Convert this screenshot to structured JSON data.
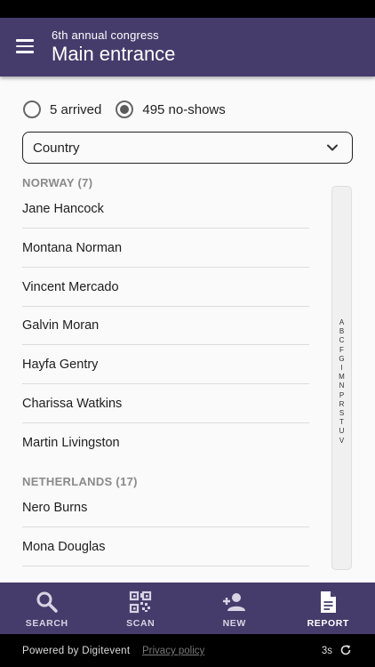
{
  "header": {
    "subtitle": "6th annual congress",
    "title": "Main entrance"
  },
  "filters": {
    "arrived_label": "5 arrived",
    "noshows_label": "495 no-shows",
    "selected": "noshows"
  },
  "group_select": {
    "value": "Country"
  },
  "sections": [
    {
      "header": "NORWAY (7)",
      "items": [
        "Jane Hancock",
        "Montana Norman",
        "Vincent Mercado",
        "Galvin Moran",
        "Hayfa Gentry",
        "Charissa Watkins",
        "Martin Livingston"
      ]
    },
    {
      "header": "NETHERLANDS (17)",
      "items": [
        "Nero Burns",
        "Mona Douglas"
      ]
    }
  ],
  "index_letters": [
    "A",
    "B",
    "C",
    "F",
    "G",
    "I",
    "M",
    "N",
    "P",
    "R",
    "S",
    "T",
    "U",
    "V"
  ],
  "bottom_nav": {
    "search": "SEARCH",
    "scan": "SCAN",
    "new": "NEW",
    "report": "REPORT",
    "active": "report"
  },
  "footer": {
    "powered_by": "Powered by Digitevent",
    "privacy": "Privacy policy",
    "timer": "3s"
  },
  "colors": {
    "primary": "#463c6b",
    "background": "#fafafa"
  }
}
